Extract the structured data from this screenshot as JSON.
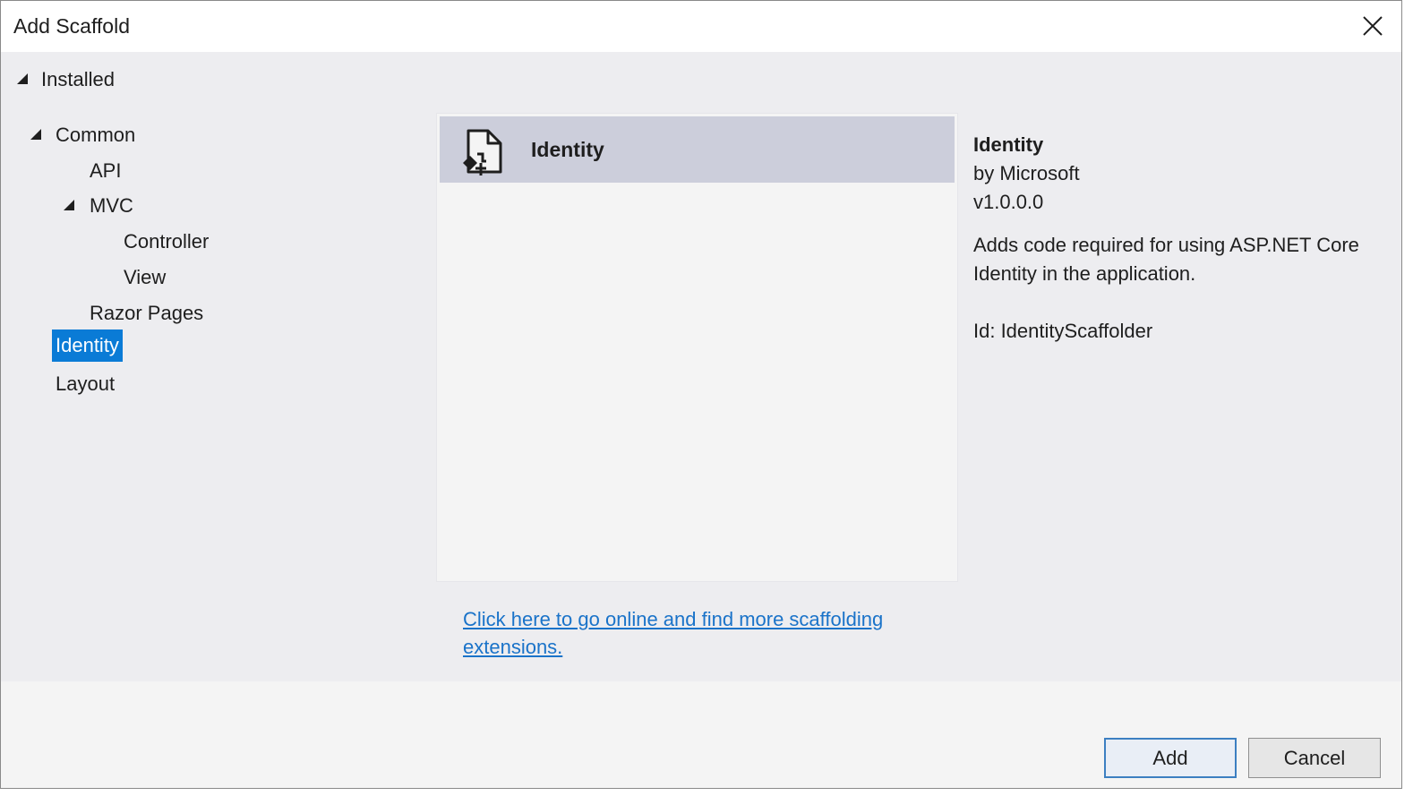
{
  "dialog": {
    "title": "Add Scaffold",
    "close_icon": "close-icon"
  },
  "tree": {
    "root_label": "Installed",
    "nodes": [
      {
        "label": "Common",
        "expanded": true
      },
      {
        "label": "API"
      },
      {
        "label": "MVC",
        "expanded": true
      },
      {
        "label": "Controller"
      },
      {
        "label": "View"
      },
      {
        "label": "Razor Pages"
      },
      {
        "label": "Identity",
        "selected": true
      },
      {
        "label": "Layout"
      }
    ]
  },
  "list": {
    "items": [
      {
        "label": "Identity",
        "icon": "scaffold-file-icon",
        "selected": true
      }
    ]
  },
  "details": {
    "title": "Identity",
    "author": "by Microsoft",
    "version": "v1.0.0.0",
    "description": "Adds code required for using ASP.NET Core Identity in the application.",
    "id_line": "Id: IdentityScaffolder"
  },
  "footer": {
    "online_link": "Click here to go online and find more scaffolding extensions.",
    "add_label": "Add",
    "cancel_label": "Cancel"
  },
  "colors": {
    "selection_blue": "#0a7bd6",
    "list_selection": "#cccedb",
    "link": "#1a73c9"
  }
}
